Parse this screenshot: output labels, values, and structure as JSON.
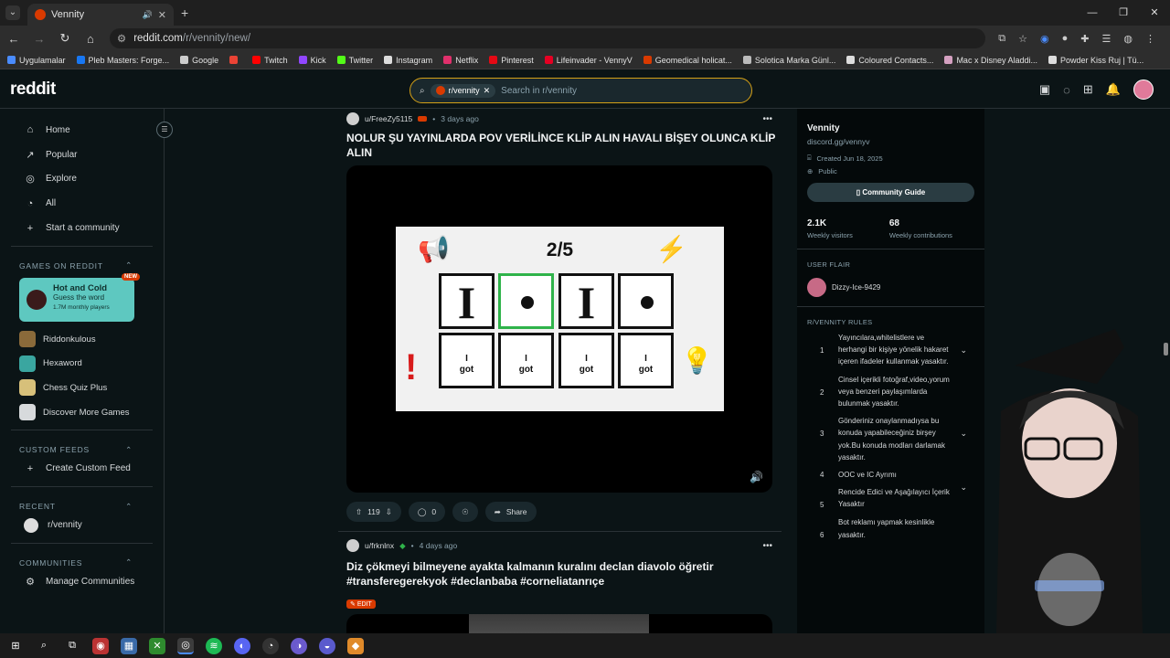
{
  "browser": {
    "tab_title": "Vennity",
    "url_host": "reddit.com",
    "url_path": "/r/vennity/new/",
    "bookmarks": [
      "Uygulamalar",
      "Pleb Masters: Forge...",
      "Google",
      "",
      "Twitch",
      "Kick",
      "Twitter",
      "Instagram",
      "Netflix",
      "Pinterest",
      "Lifeinvader - VennyV",
      "Geomedical holicat...",
      "Solotica Marka Günl...",
      "Coloured Contacts...",
      "Mac x Disney Aladdi...",
      "Powder Kiss Ruj | Tü..."
    ]
  },
  "header": {
    "logo": "reddit",
    "search_chip": "r/vennity",
    "search_placeholder": "Search in r/vennity"
  },
  "sidebar": {
    "nav": [
      {
        "label": "Home",
        "icon": "home-icon"
      },
      {
        "label": "Popular",
        "icon": "popular-icon"
      },
      {
        "label": "Explore",
        "icon": "explore-icon"
      },
      {
        "label": "All",
        "icon": "all-icon"
      },
      {
        "label": "Start a community",
        "icon": "plus-icon"
      }
    ],
    "games_header": "GAMES ON REDDIT",
    "featured_game": {
      "title": "Hot and Cold",
      "subtitle": "Guess the word",
      "players": "1.7M monthly players",
      "badge": "NEW"
    },
    "games": [
      {
        "label": "Riddonkulous",
        "color": "#8a6a3a"
      },
      {
        "label": "Hexaword",
        "color": "#3aa6a0"
      },
      {
        "label": "Chess Quiz Plus",
        "color": "#d7c07a"
      },
      {
        "label": "Discover More Games",
        "color": "#d7dadc"
      }
    ],
    "custom_feeds_header": "CUSTOM FEEDS",
    "create_custom_feed": "Create Custom Feed",
    "recent_header": "RECENT",
    "recent_item": "r/vennity",
    "communities_header": "COMMUNITIES",
    "manage_communities": "Manage Communities"
  },
  "posts": [
    {
      "user": "u/FreeZy5115",
      "time": "3 days ago",
      "title": "NOLUR ŞU YAYINLARDA POV VERİLİNCE KLİP ALIN HAVALI BİŞEY OLUNCA KLİP ALIN",
      "video": {
        "counter": "2/5",
        "top_row": [
          "I",
          "•",
          "I",
          "•"
        ],
        "bottom_row": [
          "I\ngot",
          "I\ngot",
          "I\ngot",
          "I\ngot"
        ]
      },
      "votes": "119",
      "comments": "0",
      "share": "Share"
    },
    {
      "user": "u/frknlnx",
      "time": "4 days ago",
      "title": "Diz çökmeyi bilmeyene ayakta kalmanın kuralını declan diavolo öğretir #transferegerekyok #declanbaba #corneliatanrıçe",
      "flair": "EDIT"
    }
  ],
  "community": {
    "name": "Vennity",
    "link": "discord.gg/vennyv",
    "created": "Created Jun 18, 2025",
    "visibility": "Public",
    "guide": "Community Guide",
    "visitors": "2.1K",
    "visitors_label": "Weekly visitors",
    "contributions": "68",
    "contributions_label": "Weekly contributions",
    "user_flair_header": "USER FLAIR",
    "user_flair": "Dizzy-Ice-9429",
    "rules_header": "R/VENNITY RULES",
    "rules": [
      {
        "n": "1",
        "text": "Yayıncılara,whitelistlere ve herhangi bir kişiye yönelik hakaret içeren ifadeler kullanmak yasaktır."
      },
      {
        "n": "2",
        "text": "Cinsel içerikli fotoğraf,video,yorum veya benzeri paylaşımlarda bulunmak yasaktır."
      },
      {
        "n": "3",
        "text": "Gönderiniz onaylanmadıysa bu konuda yapabileceğiniz birşey yok.Bu konuda modları darlamak yasaktır."
      },
      {
        "n": "4",
        "text": "OOC ve IC Ayrımı"
      },
      {
        "n": "5",
        "text": "Rencide Edici ve Aşağılayıcı İçerik Yasaktır"
      },
      {
        "n": "6",
        "text": "Bot reklamı yapmak kesinlikle yasaktır."
      }
    ]
  },
  "colors": {
    "accent": "#d93a00",
    "bg": "#0b1416",
    "search_border": "#d4a017",
    "game_card": "#5ec8c0"
  }
}
